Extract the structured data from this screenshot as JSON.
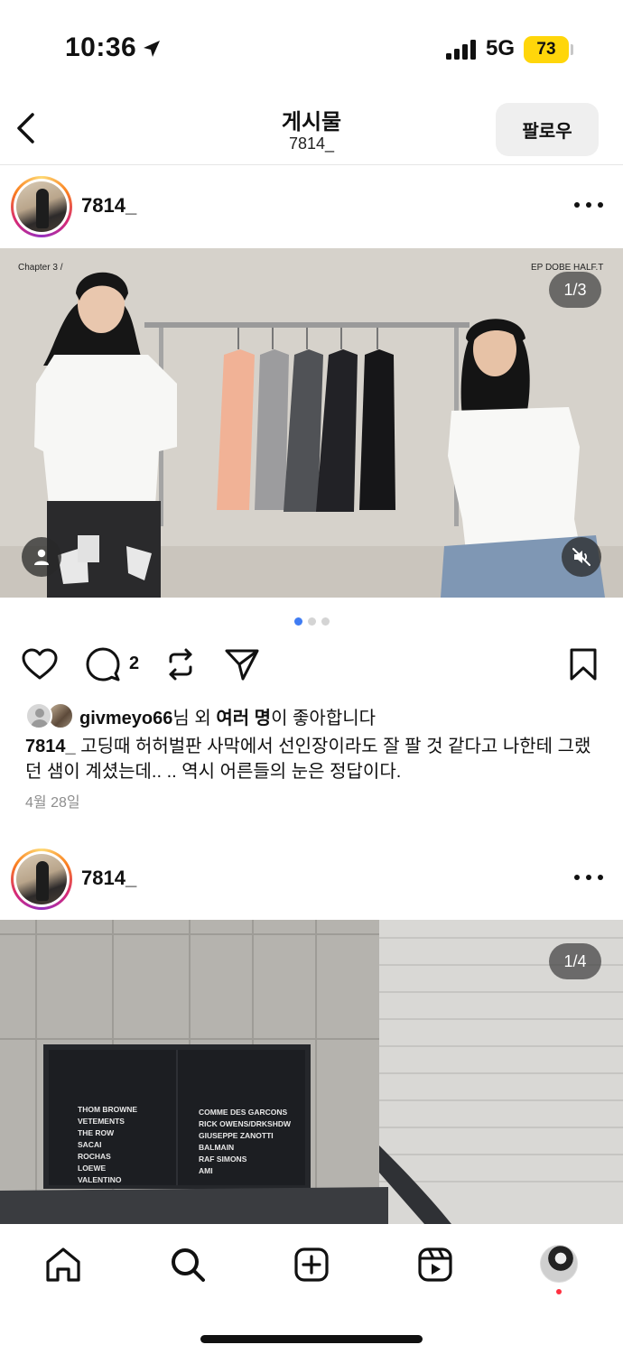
{
  "status_bar": {
    "time": "10:36",
    "network": "5G",
    "battery": "73",
    "battery_color": "#ffd60a"
  },
  "header": {
    "title": "게시물",
    "subtitle": "7814_",
    "follow_label": "팔로우"
  },
  "posts": [
    {
      "username": "7814_",
      "media_counter": "1/3",
      "media_caption_left": "Chapter 3 /",
      "media_caption_right": "EP DOBE HALF.T",
      "carousel_dots": 3,
      "carousel_active_index": 0,
      "comment_count": "2",
      "liked_by_user": "givmeyo66",
      "liked_by_suffix_1": "님 외 ",
      "liked_by_others": "여러 명",
      "liked_by_suffix_2": "이 좋아합니다",
      "caption_user": "7814_",
      "caption_text": "고딩때 허허벌판 사막에서 선인장이라도 잘 팔 것 같다고 나한테 그랬던 샘이 계셨는데.. .. 역시 어른들의 눈은 정답이다.",
      "date": "4월 28일"
    },
    {
      "username": "7814_",
      "media_counter": "1/4",
      "sign_left": [
        "THOM BROWNE",
        "VETEMENTS",
        "THE ROW",
        "SACAI",
        "ROCHAS",
        "LOEWE",
        "VALENTINO"
      ],
      "sign_right": [
        "COMME DES GARCONS",
        "RICK OWENS/DRKSHDW",
        "GIUSEPPE ZANOTTI",
        "BALMAIN",
        "RAF SIMONS",
        "AMI"
      ]
    }
  ],
  "bottom_nav": {
    "items": [
      "home-icon",
      "search-icon",
      "create-icon",
      "reels-icon",
      "profile-avatar"
    ],
    "notification_dot_color": "#ff3040"
  }
}
